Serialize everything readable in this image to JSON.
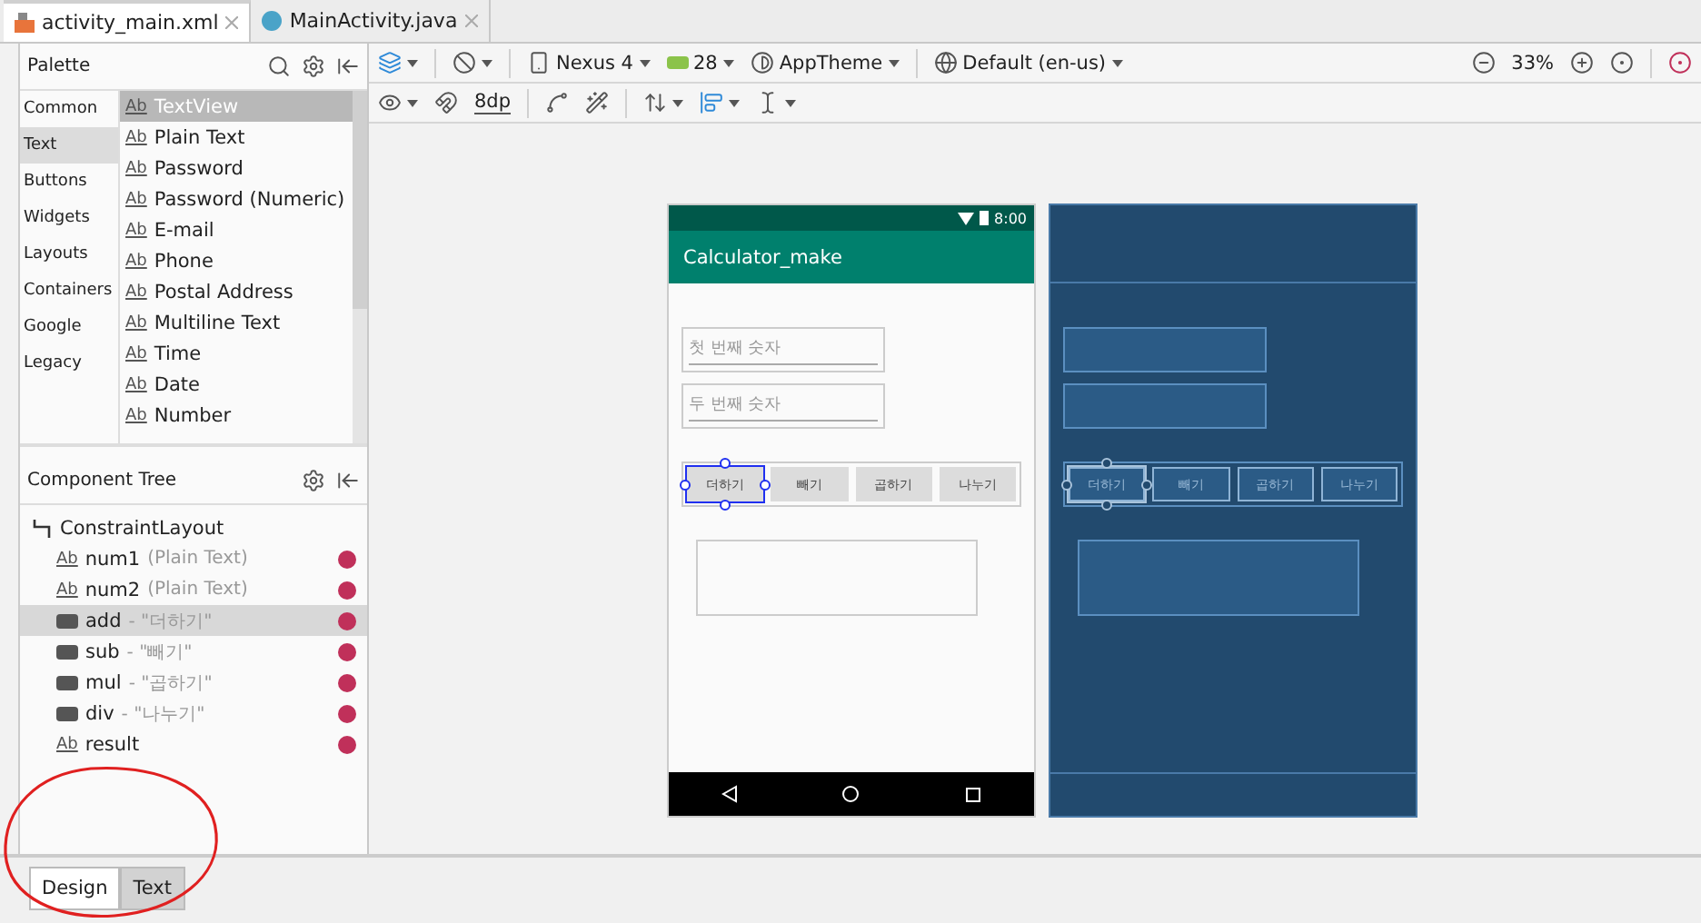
{
  "file_tabs": [
    {
      "label": "activity_main.xml",
      "kind": "xml",
      "selected": true
    },
    {
      "label": "MainActivity.java",
      "kind": "java",
      "selected": false
    }
  ],
  "palette": {
    "title": "Palette",
    "categories": [
      {
        "label": "Common",
        "selected": false
      },
      {
        "label": "Text",
        "selected": true
      },
      {
        "label": "Buttons",
        "selected": false
      },
      {
        "label": "Widgets",
        "selected": false
      },
      {
        "label": "Layouts",
        "selected": false
      },
      {
        "label": "Containers",
        "selected": false
      },
      {
        "label": "Google",
        "selected": false
      },
      {
        "label": "Legacy",
        "selected": false
      }
    ],
    "items": [
      {
        "glyph": "Ab",
        "label": "TextView",
        "selected": true
      },
      {
        "glyph": "Ab",
        "label": "Plain Text",
        "selected": false
      },
      {
        "glyph": "Ab",
        "label": "Password",
        "selected": false
      },
      {
        "glyph": "Ab",
        "label": "Password (Numeric)",
        "selected": false
      },
      {
        "glyph": "Ab",
        "label": "E-mail",
        "selected": false
      },
      {
        "glyph": "Ab",
        "label": "Phone",
        "selected": false
      },
      {
        "glyph": "Ab",
        "label": "Postal Address",
        "selected": false
      },
      {
        "glyph": "Ab",
        "label": "Multiline Text",
        "selected": false
      },
      {
        "glyph": "Ab",
        "label": "Time",
        "selected": false
      },
      {
        "glyph": "Ab",
        "label": "Date",
        "selected": false
      },
      {
        "glyph": "Ab",
        "label": "Number",
        "selected": false
      }
    ]
  },
  "component_tree": {
    "title": "Component Tree",
    "items": [
      {
        "kind": "layout",
        "name": "ConstraintLayout",
        "selected": false,
        "children": [
          {
            "kind": "edit",
            "glyph": "Ab",
            "name": "num1",
            "detail": "(Plain Text)",
            "error": true,
            "selected": false
          },
          {
            "kind": "edit",
            "glyph": "Ab",
            "name": "num2",
            "detail": "(Plain Text)",
            "error": true,
            "selected": false
          },
          {
            "kind": "button",
            "name": "add",
            "detail": "- \"더하기\"",
            "error": true,
            "selected": true
          },
          {
            "kind": "button",
            "name": "sub",
            "detail": "- \"빼기\"",
            "error": true,
            "selected": false
          },
          {
            "kind": "button",
            "name": "mul",
            "detail": "- \"곱하기\"",
            "error": true,
            "selected": false
          },
          {
            "kind": "button",
            "name": "div",
            "detail": "- \"나누기\"",
            "error": true,
            "selected": false
          },
          {
            "kind": "text",
            "glyph": "Ab",
            "name": "result",
            "error": true,
            "selected": false
          }
        ]
      }
    ]
  },
  "toolbar": {
    "device": "Nexus 4",
    "api": "28",
    "theme": "AppTheme",
    "locale": "Default (en-us)",
    "zoom": "33%",
    "margin": "8dp"
  },
  "phone": {
    "time": "8:00",
    "app_title": "Calculator_make",
    "fields": [
      {
        "placeholder": "첫 번째 숫자"
      },
      {
        "placeholder": "두 번째 숫자"
      }
    ],
    "buttons": [
      {
        "label": "더하기",
        "selected": true
      },
      {
        "label": "빼기",
        "selected": false
      },
      {
        "label": "곱하기",
        "selected": false
      },
      {
        "label": "나누기",
        "selected": false
      }
    ]
  },
  "blueprint": {
    "buttons": [
      {
        "label": "더하기",
        "selected": true
      },
      {
        "label": "빼기",
        "selected": false
      },
      {
        "label": "곱하기",
        "selected": false
      },
      {
        "label": "나누기",
        "selected": false
      }
    ]
  },
  "bottom_tabs": [
    {
      "label": "Design",
      "selected": true
    },
    {
      "label": "Text",
      "selected": false
    }
  ]
}
